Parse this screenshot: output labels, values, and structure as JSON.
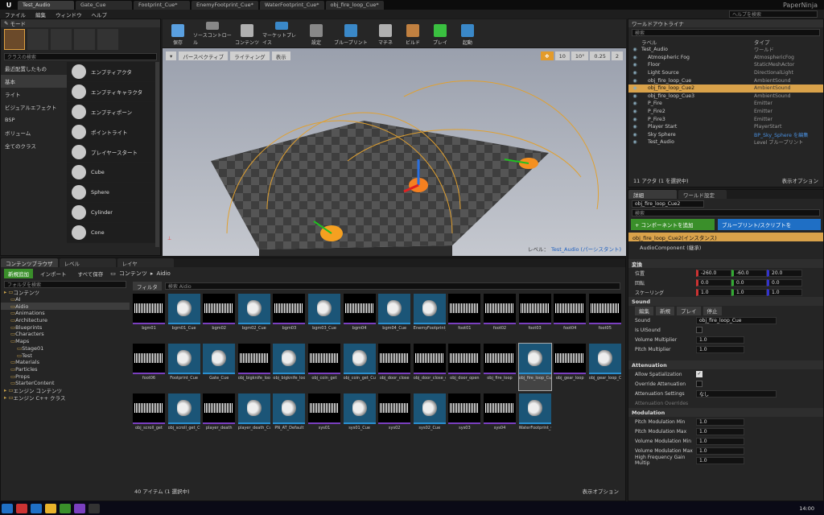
{
  "window": {
    "tabs": [
      "Test_Audio",
      "Gate_Cue",
      "Footprint_Cue*",
      "EnemyFootprint_Cue*",
      "WaterFootprint_Cue*",
      "obj_fire_loop_Cue*"
    ],
    "project": "PaperNinja",
    "help_placeholder": "ヘルプを検索"
  },
  "menu": [
    "ファイル",
    "編集",
    "ウィンドウ",
    "ヘルプ"
  ],
  "modes": {
    "title": "モード",
    "search_placeholder": "クラスの検索",
    "categories": [
      "最近配置したもの",
      "基本",
      "ライト",
      "ビジュアルエフェクト",
      "BSP",
      "ボリューム",
      "全てのクラス"
    ],
    "selected_category": "基本",
    "items": [
      "エンプティアクタ",
      "エンプティキャラクタ",
      "エンプティポーン",
      "ポイントライト",
      "プレイヤースタート",
      "Cube",
      "Sphere",
      "Cylinder",
      "Cone"
    ]
  },
  "toolbar": [
    "保存",
    "ソースコントロール",
    "コンテンツ",
    "マーケットプレイス",
    "設定",
    "ブループリント",
    "マチネ",
    "ビルド",
    "プレイ",
    "起動"
  ],
  "viewport": {
    "perspective": "パースペクティブ",
    "lighting": "ライティング",
    "show": "表示",
    "grid": "10",
    "angle": "10°",
    "scale": "0.25",
    "camera": "2",
    "level_label": "レベル：",
    "level_name": "Test_Audio (パーシスタント)"
  },
  "world_outliner": {
    "title": "ワールドアウトライナ",
    "search_placeholder": "検索",
    "col_label": "ラベル",
    "col_type": "タイプ",
    "rows": [
      {
        "name": "Test_Audio",
        "type": "ワールド"
      },
      {
        "name": "Atmospheric Fog",
        "type": "AtmosphericFog"
      },
      {
        "name": "Floor",
        "type": "StaticMeshActor"
      },
      {
        "name": "Light Source",
        "type": "DirectionalLight"
      },
      {
        "name": "obj_fire_loop_Cue",
        "type": "AmbientSound"
      },
      {
        "name": "obj_fire_loop_Cue2",
        "type": "AmbientSound"
      },
      {
        "name": "obj_fire_loop_Cue3",
        "type": "AmbientSound"
      },
      {
        "name": "P_Fire",
        "type": "Emitter"
      },
      {
        "name": "P_Fire2",
        "type": "Emitter"
      },
      {
        "name": "P_Fire3",
        "type": "Emitter"
      },
      {
        "name": "Player Start",
        "type": "PlayerStart"
      },
      {
        "name": "Sky Sphere",
        "type": "BP_Sky_Sphere を編集"
      },
      {
        "name": "Test_Audio",
        "type": "Level ブループリント"
      }
    ],
    "selected": "obj_fire_loop_Cue2",
    "count": "11 アクタ (1 を選択中)",
    "view_options": "表示オプション"
  },
  "details": {
    "tab_details": "詳細",
    "tab_world": "ワールド設定",
    "name": "obj_fire_loop_Cue2",
    "search_placeholder": "検索",
    "add_component": "+ コンポーネントを追加",
    "blueprint_script": "ブループリント/スクリプトを",
    "instance": "obj_fire_loop_Cue2(インスタンス)",
    "component": "AudioComponent (継承)",
    "transform": "変換",
    "location": "位置",
    "rotation": "回転",
    "scale": "スケーリング",
    "loc": [
      "-260.0",
      "-60.0",
      "20.0"
    ],
    "rot": [
      "0.0",
      "0.0",
      "0.0"
    ],
    "scl": [
      "1.0",
      "1.0",
      "1.0"
    ],
    "sound_section": "Sound",
    "edit": "編集",
    "new": "新規",
    "play": "プレイ",
    "stop": "停止",
    "sound_label": "Sound",
    "sound_value": "obj_fire_loop_Cue",
    "is_ui": "Is UISound",
    "vol_mult": "Volume Multiplier",
    "vol_val": "1.0",
    "pitch_mult": "Pitch Multiplier",
    "pitch_val": "1.0",
    "atten_section": "Attenuation",
    "allow_spat": "Allow Spatialization",
    "override_att": "Override Attenuation",
    "att_settings": "Attenuation Settings",
    "att_value": "なし",
    "att_overrides": "Attenuation Overrides",
    "mod_section": "Modulation",
    "pitch_min": "Pitch Modulation Min",
    "pitch_max": "Pitch Modulation Max",
    "vol_min": "Volume Modulation Min",
    "vol_max": "Volume Modulation Max",
    "hf_min": "High Frequency Gain Multip",
    "mod_val": "1.0"
  },
  "content": {
    "tab_browser": "コンテンツブラウザ",
    "tab_level": "レベル",
    "tab_layer": "レイヤ",
    "new": "新規追加",
    "import": "インポート",
    "save_all": "すべて保存",
    "path_root": "コンテンツ",
    "path_folder": "Aidio",
    "folder_search": "フォルダを検索",
    "filter": "フィルタ",
    "search_placeholder": "検索 Aidio",
    "count": "40 アイテム (1 選択中)",
    "view_options": "表示オプション",
    "tree": [
      "コンテンツ",
      "AI",
      "Aidio",
      "Animations",
      "Architecture",
      "Blueprints",
      "Characters",
      "Maps",
      "Stage01",
      "Test",
      "Materials",
      "Particles",
      "Props",
      "StarterContent",
      "エンジン コンテンツ",
      "エンジン C++ クラス"
    ],
    "assets": [
      {
        "n": "bgm01",
        "c": false
      },
      {
        "n": "bgm01_Cue",
        "c": true
      },
      {
        "n": "bgm02",
        "c": false
      },
      {
        "n": "bgm02_Cue",
        "c": true
      },
      {
        "n": "bgm03",
        "c": false
      },
      {
        "n": "bgm03_Cue",
        "c": true
      },
      {
        "n": "bgm04",
        "c": false
      },
      {
        "n": "bgm04_Cue",
        "c": true
      },
      {
        "n": "EnemyFootprint_Cue",
        "c": true
      },
      {
        "n": "foot01",
        "c": false
      },
      {
        "n": "foot02",
        "c": false
      },
      {
        "n": "foot03",
        "c": false
      },
      {
        "n": "foot04",
        "c": false
      },
      {
        "n": "foot05",
        "c": false
      },
      {
        "n": "foot06",
        "c": false
      },
      {
        "n": "Footprint_Cue",
        "c": true
      },
      {
        "n": "Gate_Cue",
        "c": true
      },
      {
        "n": "obj_bigknife_loop",
        "c": false
      },
      {
        "n": "obj_bigknife_loop_Cue",
        "c": true
      },
      {
        "n": "obj_coin_get",
        "c": false
      },
      {
        "n": "obj_coin_get_Cue",
        "c": true
      },
      {
        "n": "obj_door_close",
        "c": false
      },
      {
        "n": "obj_door_close_end",
        "c": false
      },
      {
        "n": "obj_door_open",
        "c": false
      },
      {
        "n": "obj_fire_loop",
        "c": false
      },
      {
        "n": "obj_fire_loop_Cue",
        "c": true
      },
      {
        "n": "obj_gear_loop",
        "c": false
      },
      {
        "n": "obj_gear_loop_Cue",
        "c": true
      },
      {
        "n": "obj_scroll_get",
        "c": false
      },
      {
        "n": "obj_scroll_get_Cue",
        "c": true
      },
      {
        "n": "player_death",
        "c": false
      },
      {
        "n": "player_death_Cue",
        "c": true
      },
      {
        "n": "PN_AT_Default",
        "c": true
      },
      {
        "n": "sys01",
        "c": false
      },
      {
        "n": "sys01_Cue",
        "c": true
      },
      {
        "n": "sys02",
        "c": false
      },
      {
        "n": "sys02_Cue",
        "c": true
      },
      {
        "n": "sys03",
        "c": false
      },
      {
        "n": "sys04",
        "c": false
      },
      {
        "n": "WaterFootprint_Cue",
        "c": true
      }
    ]
  },
  "taskbar": {
    "clock": "14:00"
  },
  "colors": {
    "accent_blue": "#1f6fc5",
    "selected_row": "#d9a24a",
    "green_btn": "#3a8f2a"
  }
}
